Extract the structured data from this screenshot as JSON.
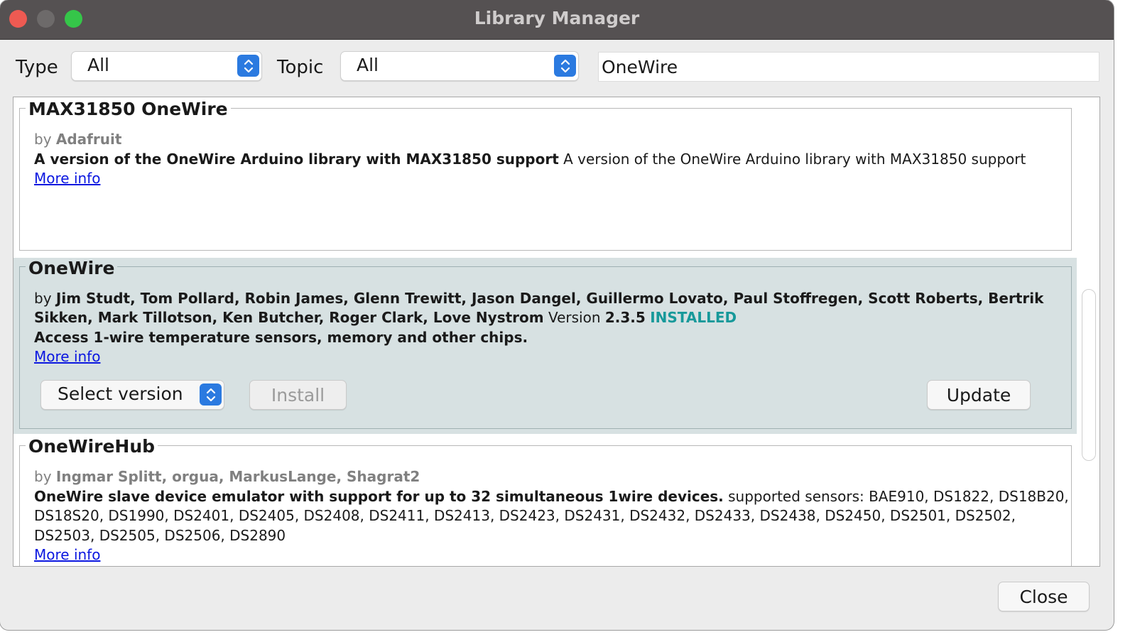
{
  "window": {
    "title": "Library Manager"
  },
  "filters": {
    "type_label": "Type",
    "type_value": "All",
    "topic_label": "Topic",
    "topic_value": "All",
    "search_value": "OneWire"
  },
  "libraries": [
    {
      "name": "MAX31850 OneWire",
      "by": "by",
      "author": "Adafruit",
      "sentence": "A version of the OneWire Arduino library with MAX31850 support",
      "paragraph": "A version of the OneWire Arduino library with MAX31850 support",
      "more_info": "More info"
    },
    {
      "name": "OneWire",
      "by": "by",
      "authors_line1": "Jim Studt, Tom Pollard, Robin James, Glenn Trewitt, Jason Dangel, Guillermo Lovato, Paul Stoffregen, Scott Roberts, Bertrik",
      "authors_line2": "Sikken, Mark Tillotson, Ken Butcher, Roger Clark, Love Nystrom",
      "version_label": "Version",
      "version": "2.3.5",
      "status": "INSTALLED",
      "sentence": "Access 1-wire temperature sensors, memory and other chips.",
      "more_info": "More info",
      "select_version": "Select version",
      "install_label": "Install",
      "update_label": "Update"
    },
    {
      "name": "OneWireHub",
      "by": "by",
      "author": "Ingmar Splitt, orgua, MarkusLange, Shagrat2",
      "sentence": "OneWire slave device emulator with support for up to 32 simultaneous 1wire devices.",
      "paragraph_line1": "supported sensors: BAE910, DS1822, DS18B20,",
      "paragraph_line2": "DS18S20, DS1990, DS2401, DS2405, DS2408, DS2411, DS2413, DS2423, DS2431, DS2432, DS2433, DS2438, DS2450, DS2501, DS2502,",
      "paragraph_line3": "DS2503, DS2505, DS2506, DS2890",
      "more_info": "More info"
    }
  ],
  "footer": {
    "close_label": "Close"
  },
  "colors": {
    "accent": "#2b7ae0",
    "installed": "#17999a",
    "link": "#0b17e0",
    "selected_bg": "#d7e1e2"
  },
  "icons": {
    "dropdown": "chevron-updown-icon"
  }
}
